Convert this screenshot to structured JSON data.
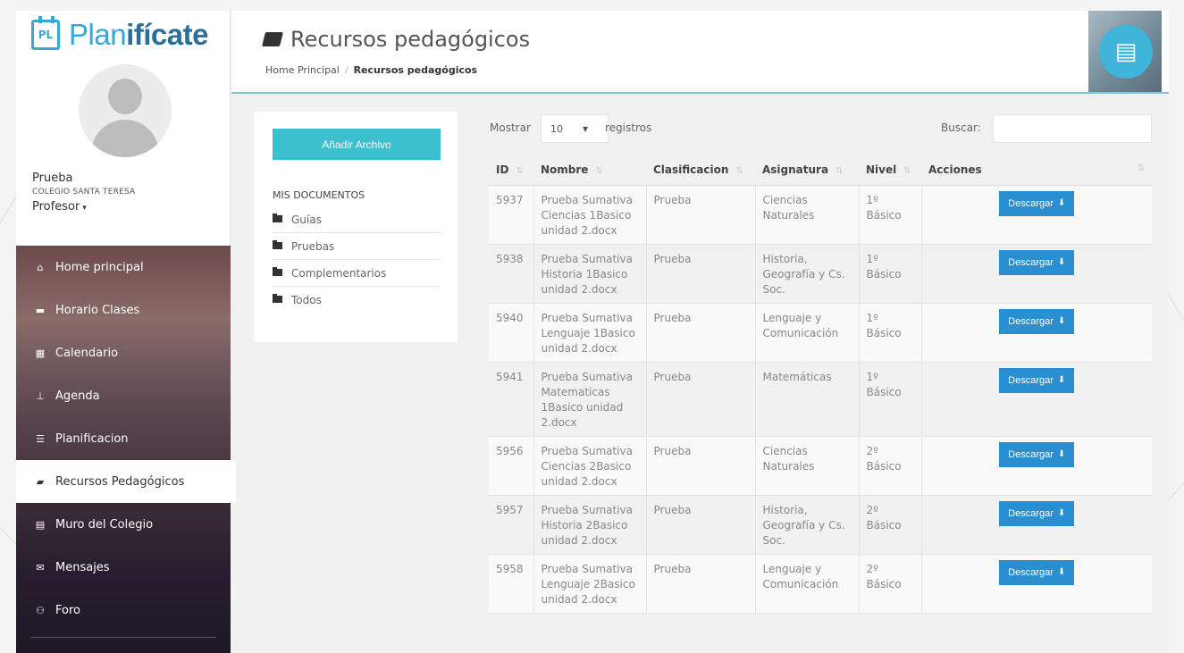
{
  "logo": {
    "box": "PL",
    "part1": "Plan",
    "part2": "ifícate"
  },
  "user": {
    "name": "Prueba",
    "school": "COLEGIO SANTA TERESA",
    "role": "Profesor"
  },
  "menu": [
    {
      "label": "Home principal",
      "icon": "home-icon",
      "glyph": "⌂"
    },
    {
      "label": "Horario Clases",
      "icon": "graduation-cap-icon",
      "glyph": "▬"
    },
    {
      "label": "Calendario",
      "icon": "calendar-icon",
      "glyph": "▦"
    },
    {
      "label": "Agenda",
      "icon": "pin-icon",
      "glyph": "⊥"
    },
    {
      "label": "Planificacion",
      "icon": "list-icon",
      "glyph": "☰"
    },
    {
      "label": "Recursos Pedagógicos",
      "icon": "book-icon",
      "glyph": "▰"
    },
    {
      "label": "Muro del Colegio",
      "icon": "newspaper-icon",
      "glyph": "▤"
    },
    {
      "label": "Mensajes",
      "icon": "envelope-icon",
      "glyph": "✉"
    },
    {
      "label": "Foro",
      "icon": "users-icon",
      "glyph": "⚇"
    }
  ],
  "header": {
    "title": "Recursos pedagógicos",
    "breadcrumb_home": "Home Principal",
    "breadcrumb_sep": "/",
    "breadcrumb_current": "Recursos pedagógicos"
  },
  "panel": {
    "add_button": "Añadir Archivo",
    "docs_title": "MIS DOCUMENTOS",
    "folders": [
      "Guías",
      "Pruebas",
      "Complementarios",
      "Todos"
    ]
  },
  "table_controls": {
    "show_label": "Mostrar",
    "show_value": "10",
    "records_label": "registros",
    "search_label": "Buscar:",
    "search_value": ""
  },
  "table": {
    "columns": [
      "ID",
      "Nombre",
      "Clasificacion",
      "Asignatura",
      "Nivel",
      "Acciones"
    ],
    "download_label": "Descargar",
    "rows": [
      {
        "id": "5937",
        "nombre": "Prueba Sumativa Ciencias 1Basico unidad 2.docx",
        "clasificacion": "Prueba",
        "asignatura": "Ciencias Naturales",
        "nivel": "1º Básico"
      },
      {
        "id": "5938",
        "nombre": "Prueba Sumativa Historia 1Basico unidad 2.docx",
        "clasificacion": "Prueba",
        "asignatura": "Historia, Geografía y Cs. Soc.",
        "nivel": "1º Básico"
      },
      {
        "id": "5940",
        "nombre": "Prueba Sumativa Lenguaje 1Basico unidad 2.docx",
        "clasificacion": "Prueba",
        "asignatura": "Lenguaje y Comunicación",
        "nivel": "1º Básico"
      },
      {
        "id": "5941",
        "nombre": "Prueba Sumativa Matematicas 1Basico unidad 2.docx",
        "clasificacion": "Prueba",
        "asignatura": "Matemáticas",
        "nivel": "1º Básico"
      },
      {
        "id": "5956",
        "nombre": "Prueba Sumativa Ciencias 2Basico unidad 2.docx",
        "clasificacion": "Prueba",
        "asignatura": "Ciencias Naturales",
        "nivel": "2º Básico"
      },
      {
        "id": "5957",
        "nombre": "Prueba Sumativa Historia 2Basico unidad 2.docx",
        "clasificacion": "Prueba",
        "asignatura": "Historia, Geografía y Cs. Soc.",
        "nivel": "2º Básico"
      },
      {
        "id": "5958",
        "nombre": "Prueba Sumativa Lenguaje 2Basico unidad 2.docx",
        "clasificacion": "Prueba",
        "asignatura": "Lenguaje y Comunicación",
        "nivel": "2º Básico"
      }
    ]
  },
  "colors": {
    "accent": "#35a8d6",
    "button": "#3cbfcf",
    "download": "#2a8fd0"
  }
}
